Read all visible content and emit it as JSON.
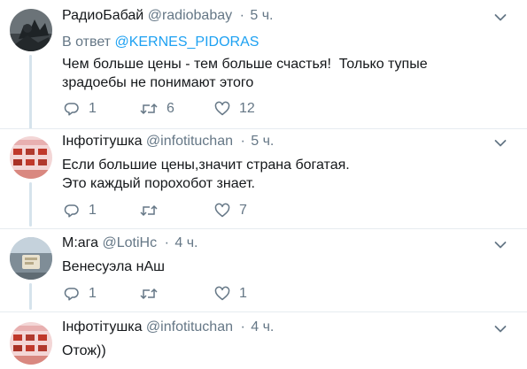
{
  "tweets": [
    {
      "name": "РадиоБабай",
      "handle": "@radiobabay",
      "dot": "·",
      "time": "5 ч.",
      "reply_prefix": "В ответ",
      "reply_mention": "@KERNES_PIDORAS",
      "text_lines": [
        "Чем больше цены - тем больше счастья!  Только тупые",
        "зрадоебы не понимают этого"
      ],
      "replies": "1",
      "retweets": "6",
      "likes": "12"
    },
    {
      "name": "Інфотітушка",
      "handle": "@infotituchan",
      "dot": "·",
      "time": "5 ч.",
      "text_lines": [
        "Если большие цены,значит страна богатая.",
        "Это каждый порохобот знает."
      ],
      "replies": "1",
      "retweets": "",
      "likes": "7"
    },
    {
      "name": "М:ага",
      "handle": "@LotiHc",
      "dot": "·",
      "time": "4 ч.",
      "text_lines": [
        "Венесуэла нАш"
      ],
      "replies": "1",
      "retweets": "",
      "likes": "1"
    },
    {
      "name": "Інфотітушка",
      "handle": "@infotituchan",
      "dot": "·",
      "time": "4 ч.",
      "text_lines": [
        "Отож))"
      ]
    }
  ],
  "icons": {
    "reply": "reply-icon",
    "retweet": "retweet-icon",
    "like": "heart-icon",
    "menu": "chevron-down-icon"
  },
  "colors": {
    "text": "#14171a",
    "muted": "#657786",
    "link": "#1da1f2",
    "thread_line": "#d6e3ec",
    "divider": "#e6ecf0"
  }
}
